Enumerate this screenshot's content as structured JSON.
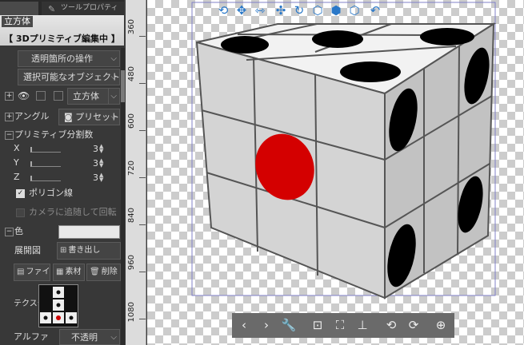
{
  "panel": {
    "tab_label": "ツールプロパティ",
    "title": "立方体",
    "mode_label": "【 3Dプリミティブ編集中 】",
    "transparent_ops": "透明箇所の操作",
    "selectable_objects": "選択可能なオブジェクト",
    "object_name": "立方体",
    "angle_label": "アングル",
    "preset_label": "プリセット",
    "divisions_label": "プリミティブ分割数",
    "axes": [
      {
        "label": "X",
        "value": "3"
      },
      {
        "label": "Y",
        "value": "3"
      },
      {
        "label": "Z",
        "value": "3"
      }
    ],
    "polygon_lines": "ポリゴン線",
    "follow_camera": "カメラに追随して回転",
    "color_label": "色",
    "unfold_label": "展開図",
    "export_label": "書き出し",
    "file_btn": "ファイ",
    "material_btn": "素材",
    "delete_btn": "削除",
    "texture_label": "テクスチ",
    "alpha_label": "アルファ",
    "alpha_value": "不透明"
  },
  "ruler": {
    "labels": [
      "360",
      "480",
      "600",
      "720",
      "840",
      "960",
      "1080"
    ]
  },
  "canvas": {
    "top_toolbar_icons": [
      "rotate-camera-icon",
      "pan-camera-icon",
      "dolly-camera-icon",
      "move-object-icon",
      "rotate-object-icon",
      "cube-select-icon",
      "cube-rotate-icon",
      "cube-reset-icon",
      "undo-camera-icon"
    ],
    "bottom_toolbar_icons": [
      "prev-icon",
      "next-icon",
      "wrench-icon",
      "camera-fit-icon",
      "frame-select-icon",
      "ground-icon",
      "rotate-ccw-icon",
      "rotate-cw-icon",
      "globe-icon"
    ]
  },
  "colors": {
    "accent": "#2a78c8",
    "cube_face": "#dcdcdc",
    "red_dot": "#d40000"
  }
}
